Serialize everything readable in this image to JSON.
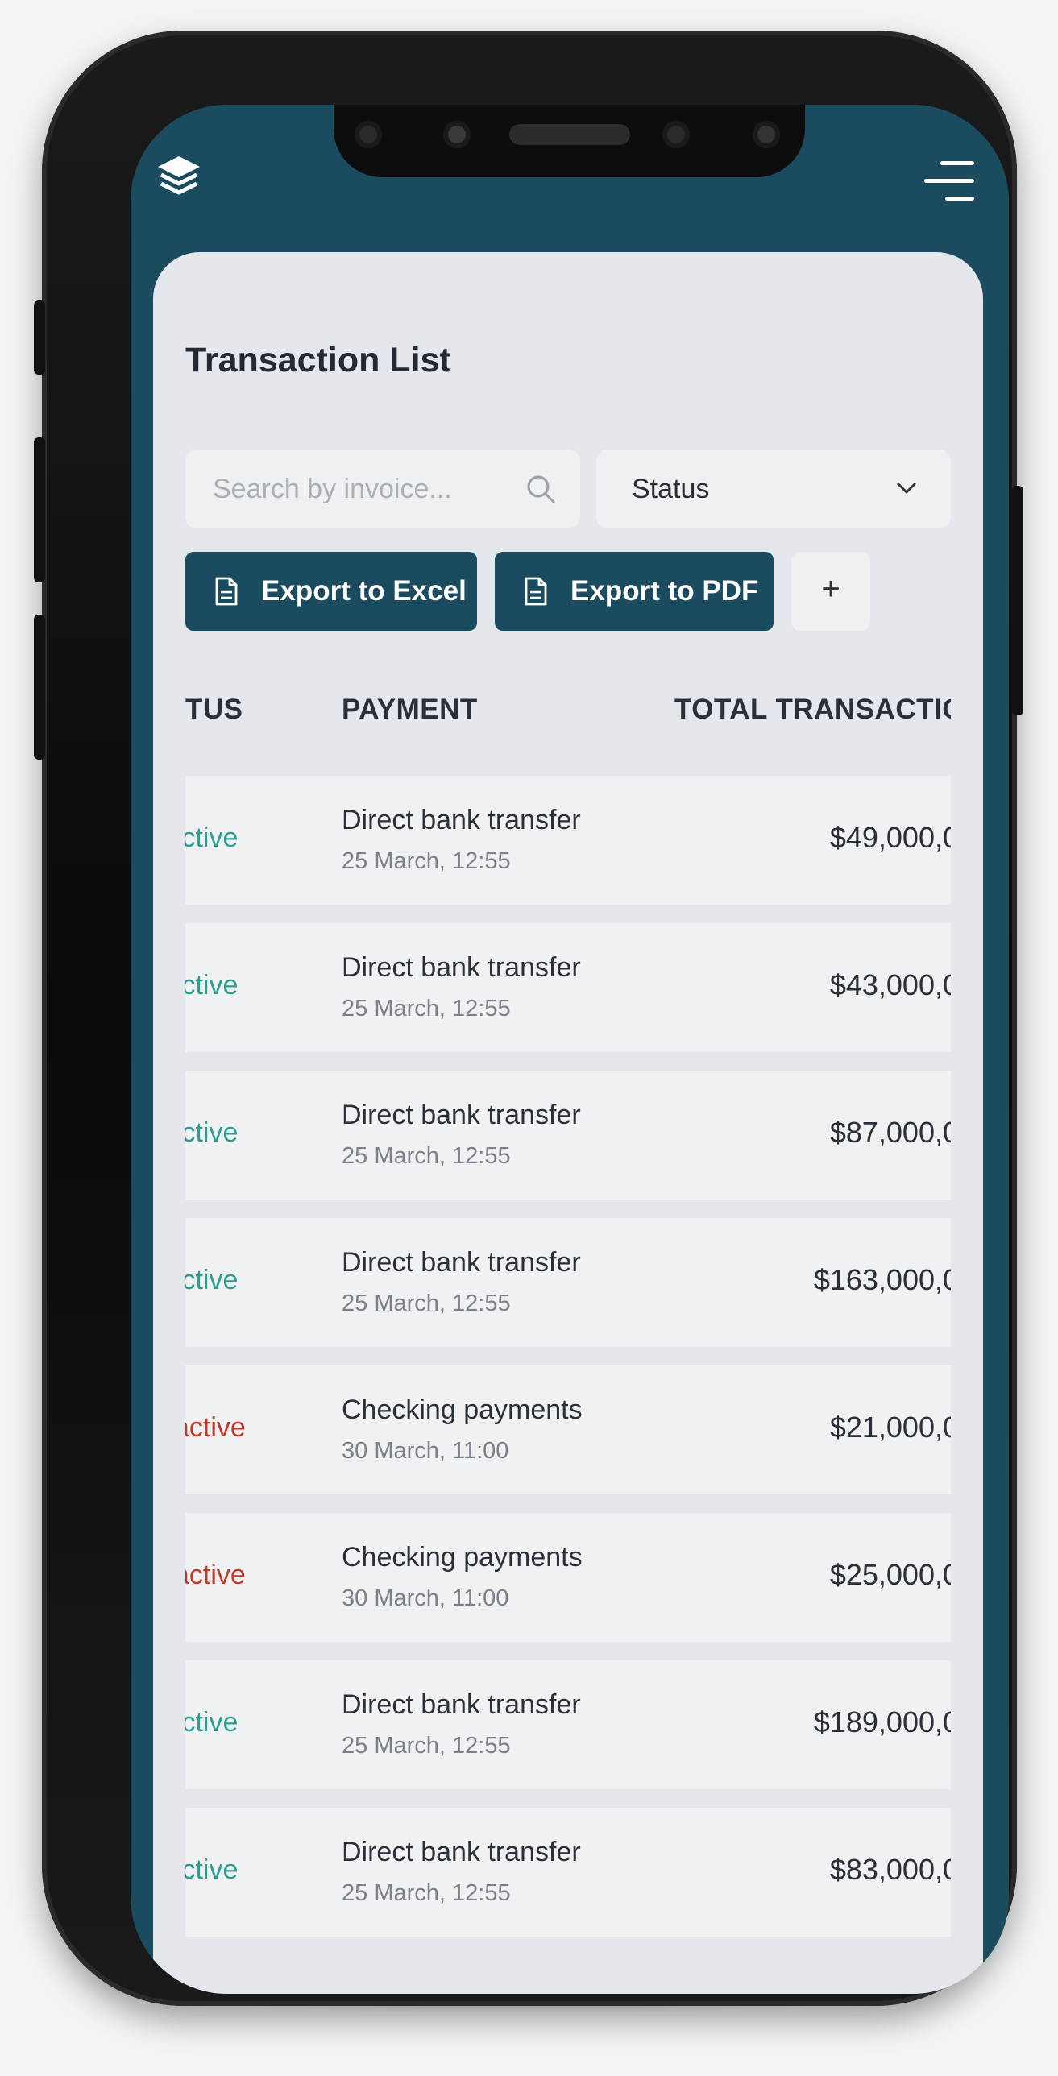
{
  "header": {
    "logo_icon": "layers-icon",
    "menu_icon": "menu-icon"
  },
  "page": {
    "title": "Transaction List"
  },
  "search": {
    "placeholder": "Search by invoice..."
  },
  "filters": {
    "status_label": "Status"
  },
  "actions": {
    "export_excel": "Export to Excel",
    "export_pdf": "Export to PDF",
    "add": "+"
  },
  "table": {
    "columns": [
      "TUS",
      "PAYMENT",
      "TOTAL TRANSACTIOI"
    ],
    "rows": [
      {
        "status": ".ctive",
        "state": "active",
        "payment": "Direct bank transfer",
        "date": "25 March, 12:55",
        "amount": "$49,000,0("
      },
      {
        "status": ".ctive",
        "state": "active",
        "payment": "Direct bank transfer",
        "date": "25 March, 12:55",
        "amount": "$43,000,0("
      },
      {
        "status": ".ctive",
        "state": "active",
        "payment": "Direct bank transfer",
        "date": "25 March, 12:55",
        "amount": "$87,000,0("
      },
      {
        "status": ".ctive",
        "state": "active",
        "payment": "Direct bank transfer",
        "date": "25 March, 12:55",
        "amount": "$163,000,0("
      },
      {
        "status": "active",
        "state": "inactive",
        "payment": "Checking payments",
        "date": "30 March, 11:00",
        "amount": "$21,000,0("
      },
      {
        "status": "active",
        "state": "inactive",
        "payment": "Checking payments",
        "date": "30 March, 11:00",
        "amount": "$25,000,0("
      },
      {
        "status": ".ctive",
        "state": "active",
        "payment": "Direct bank transfer",
        "date": "25 March, 12:55",
        "amount": "$189,000,0("
      },
      {
        "status": ".ctive",
        "state": "active",
        "payment": "Direct bank transfer",
        "date": "25 March, 12:55",
        "amount": "$83,000,0("
      }
    ]
  },
  "colors": {
    "brand": "#1a4b5e",
    "active": "#2a9d8f",
    "inactive": "#c0392b"
  }
}
